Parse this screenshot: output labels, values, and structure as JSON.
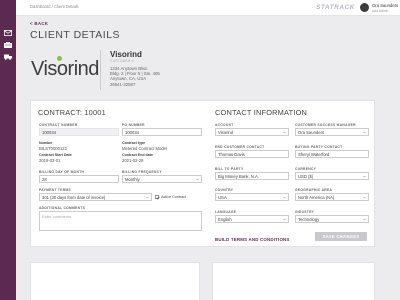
{
  "sidebar": {
    "items": [
      {
        "icon": "mail-icon"
      },
      {
        "icon": "building-icon"
      },
      {
        "icon": "vehicle-icon"
      }
    ],
    "colors": {
      "bg": "#5c2952",
      "icon": "#ffffff"
    }
  },
  "topbar": {
    "breadcrumb": "Dashboard / Client Details",
    "brand": "STATRACK",
    "user": {
      "name": "Ora Saunders",
      "role": "Ada Admin"
    }
  },
  "back_label": "< BACK",
  "page_title": "CLIENT DETAILS",
  "client": {
    "logo_text": "Visorind",
    "name": "Visorind",
    "subtitle": "CUSTOMER #",
    "address": "1234 Anytown Blvd.\nBldg. 2 | Floor 5 | Ste. 405\nAnytown, CA, USA\n26541-32587"
  },
  "contract": {
    "title": "CONTRACT: 10001",
    "fields": {
      "contract_number": {
        "label": "CONTRACT NUMBER",
        "value": "100034"
      },
      "po_number": {
        "label": "PO NUMBER",
        "value": "100034"
      },
      "billing_day": {
        "label": "BILLING DAY OF MONTH",
        "value": "28"
      },
      "billing_frequency": {
        "label": "BILLING FREQUENCY",
        "value": "Monthly"
      },
      "payment_terms": {
        "label": "PAYMENT TERMS",
        "value": "301 (30 days from date of invoice)"
      },
      "additional_comments": {
        "label": "ADDITIONAL COMMENTS",
        "placeholder": "Enter comments"
      }
    },
    "static": {
      "number": {
        "label": "Number",
        "value": "BILST0000122"
      },
      "type": {
        "label": "Contract type",
        "value": "Metered Contract Model"
      },
      "start": {
        "label": "Contract Start Date",
        "value": "2019-03-01"
      },
      "end": {
        "label": "Contract End date",
        "value": "2021-02-28"
      }
    },
    "active_label": "Active Contract",
    "active_checked": true
  },
  "contact": {
    "title": "CONTACT INFORMATION",
    "fields": {
      "account": {
        "label": "ACCOUNT",
        "value": "Visorind"
      },
      "csm": {
        "label": "CUSTOMER SUCCESS MANAGER",
        "value": "Ora Saunders"
      },
      "erd_contact": {
        "label": "ERD CUSTOMER CONTACT",
        "value": "Thomas Davis"
      },
      "buying_contact": {
        "label": "BUYING PARTY CONTACT",
        "value": "Sheryl Waterford"
      },
      "bill_to": {
        "label": "BILL TO PARTY",
        "value": "Big Money Bank, N.A."
      },
      "currency": {
        "label": "CURRENCY",
        "value": "USD ($)"
      },
      "country": {
        "label": "COUNTRY",
        "value": "USA"
      },
      "geo": {
        "label": "GEOGRAPHIC AREA",
        "value": "North America (NA)"
      },
      "language": {
        "label": "LANGUAGE",
        "value": "English"
      },
      "industry": {
        "label": "INDUSTRY",
        "value": "Technology"
      }
    },
    "build_terms": "BUILD TERMS AND CONDITIONS"
  },
  "save_label": "SAVE CHANGES",
  "colors": {
    "accent": "#5c2952",
    "logo_dot": "#86c43f",
    "background": "#ecebee"
  }
}
